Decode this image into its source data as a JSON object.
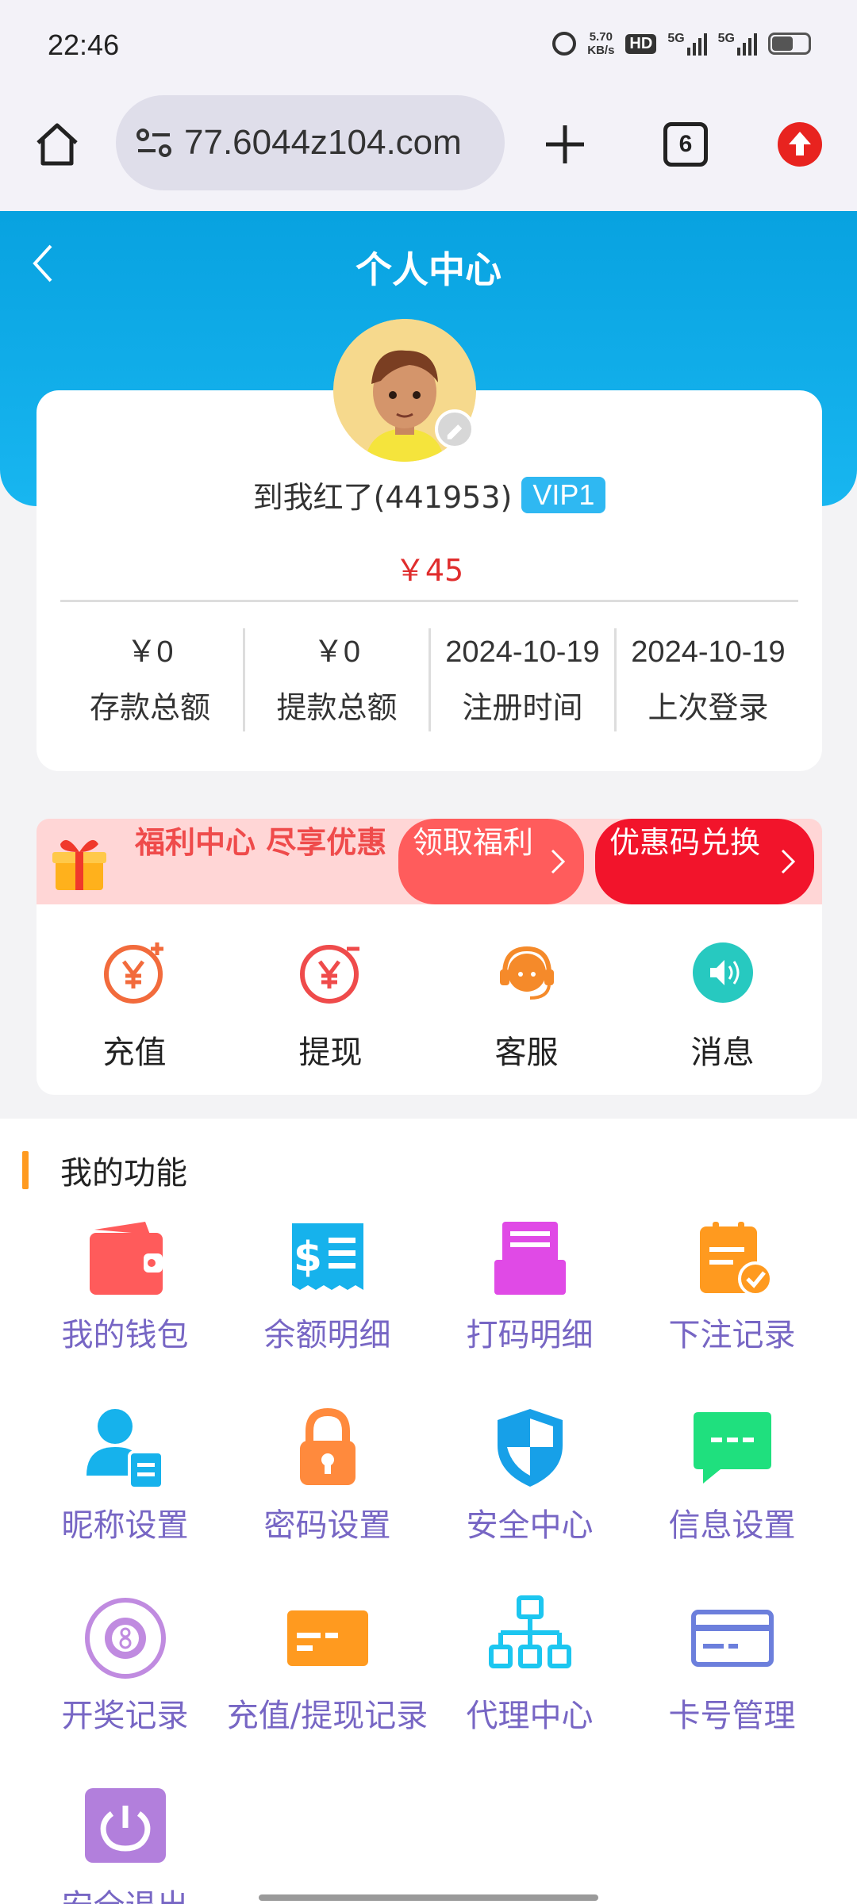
{
  "status_bar": {
    "time": "22:46",
    "speed_value": "5.70",
    "speed_unit": "KB/s",
    "hd_label": "HD",
    "signal_1": "5G",
    "signal_2": "5G",
    "icons": [
      "alarm-icon",
      "hd-voice-icon",
      "signal-icon",
      "signal-icon",
      "battery-icon"
    ]
  },
  "browser": {
    "url": "77.6044z104.com",
    "tab_count": "6",
    "icons": [
      "home-icon",
      "site-info-icon",
      "plus-icon",
      "tabs-icon",
      "update-icon"
    ]
  },
  "header": {
    "title": "个人中心"
  },
  "profile": {
    "username": "到我红了(441953)",
    "vip": "VIP1",
    "balance": "￥45",
    "stats": [
      {
        "value": "￥0",
        "label": "存款总额"
      },
      {
        "value": "￥0",
        "label": "提款总额"
      },
      {
        "value": "2024-10-19",
        "label": "注册时间"
      },
      {
        "value": "2024-10-19",
        "label": "上次登录"
      }
    ]
  },
  "promo": {
    "text": "福利中心 尽享优惠",
    "button_1": "领取福利",
    "button_2": "优惠码兑换"
  },
  "quick_actions": [
    {
      "label": "充值",
      "icon": "recharge-icon",
      "color": "#f26b3c"
    },
    {
      "label": "提现",
      "icon": "withdraw-icon",
      "color": "#ef4b4b"
    },
    {
      "label": "客服",
      "icon": "customer-service-icon",
      "color": "#f58a2a"
    },
    {
      "label": "消息",
      "icon": "message-icon",
      "color": "#27c9c0"
    }
  ],
  "functions": {
    "title": "我的功能",
    "items": [
      {
        "label": "我的钱包",
        "icon": "wallet-icon",
        "color": "#ff5b5b"
      },
      {
        "label": "余额明细",
        "icon": "balance-detail-icon",
        "color": "#16b2ec"
      },
      {
        "label": "打码明细",
        "icon": "bet-code-detail-icon",
        "color": "#e04ae6"
      },
      {
        "label": "下注记录",
        "icon": "bet-record-icon",
        "color": "#ff9a1f"
      },
      {
        "label": "昵称设置",
        "icon": "nickname-icon",
        "color": "#16b2ec"
      },
      {
        "label": "密码设置",
        "icon": "lock-icon",
        "color": "#ff8a3d"
      },
      {
        "label": "安全中心",
        "icon": "shield-icon",
        "color": "#17a0e8"
      },
      {
        "label": "信息设置",
        "icon": "chat-bubble-icon",
        "color": "#1fe07e"
      },
      {
        "label": "开奖记录",
        "icon": "lottery-ball-icon",
        "color": "#c08be0"
      },
      {
        "label": "充值/提现记录",
        "icon": "card-record-icon",
        "color": "#ff9a1f"
      },
      {
        "label": "代理中心",
        "icon": "org-chart-icon",
        "color": "#1cc6f0"
      },
      {
        "label": "卡号管理",
        "icon": "bank-card-icon",
        "color": "#6c7fdc"
      },
      {
        "label": "安全退出",
        "icon": "power-icon",
        "color": "#b27fdc"
      }
    ]
  }
}
